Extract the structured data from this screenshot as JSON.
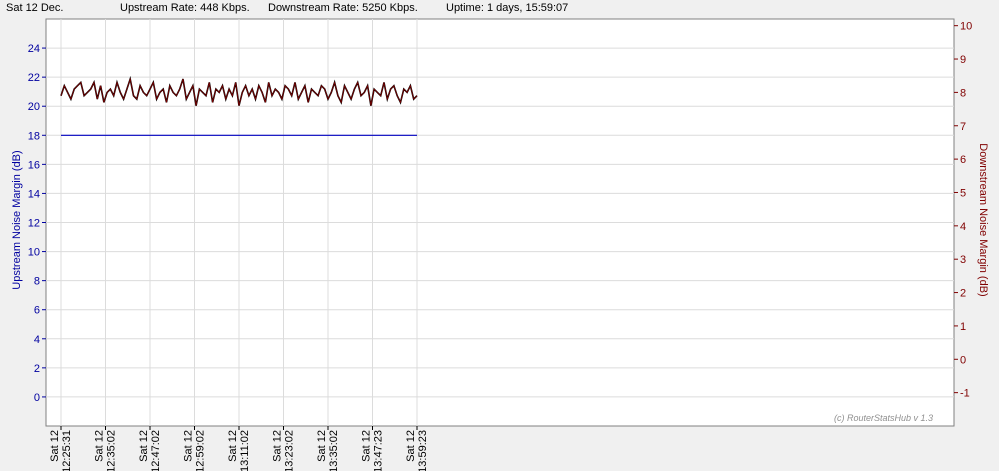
{
  "header": {
    "date": "Sat 12 Dec.",
    "upstream_rate": "Upstream Rate: 448 Kbps.",
    "downstream_rate": "Downstream Rate: 5250 Kbps.",
    "uptime": "Uptime: 1 days, 15:59:07"
  },
  "watermark": "(c) RouterStatsHub v 1.3",
  "colors": {
    "upstream": "#0000c0",
    "downstream": "#800000",
    "downstream_outline": "#000000",
    "grid": "#dcdcdc",
    "plot_bg": "#ffffff"
  },
  "chart_data": {
    "type": "line",
    "ylabel": "Upstream Noise Margin (dB)",
    "y2label": "Downstream Noise Margin (dB)",
    "ylim": [
      -2,
      26
    ],
    "y2lim": [
      -2,
      10.2
    ],
    "yticks": [
      0,
      2,
      4,
      6,
      8,
      10,
      12,
      14,
      16,
      18,
      20,
      22,
      24
    ],
    "y2ticks": [
      -1,
      0,
      1,
      2,
      3,
      4,
      5,
      6,
      7,
      8,
      9,
      10
    ],
    "grid": true,
    "x_labels": [
      [
        "Sat 12",
        "12:25:31"
      ],
      [
        "Sat 12",
        "12:35:02"
      ],
      [
        "Sat 12",
        "12:47:02"
      ],
      [
        "Sat 12",
        "12:59:02"
      ],
      [
        "Sat 12",
        "13:11:02"
      ],
      [
        "Sat 12",
        "13:23:02"
      ],
      [
        "Sat 12",
        "13:35:02"
      ],
      [
        "Sat 12",
        "13:47:23"
      ],
      [
        "Sat 12",
        "13:59:23"
      ]
    ],
    "series": [
      {
        "name": "Upstream Noise Margin (dB)",
        "axis": "left",
        "values": [
          18,
          18
        ]
      },
      {
        "name": "Downstream Noise Margin (dB)",
        "axis": "right",
        "values": [
          7.9,
          8.2,
          8.0,
          7.8,
          8.1,
          8.2,
          8.3,
          7.9,
          8.0,
          8.1,
          8.3,
          7.8,
          8.2,
          7.7,
          8.0,
          8.1,
          7.9,
          8.3,
          8.0,
          7.8,
          8.1,
          8.4,
          7.9,
          7.8,
          8.2,
          8.0,
          7.9,
          8.1,
          8.3,
          7.8,
          8.0,
          8.1,
          7.7,
          8.2,
          8.0,
          7.9,
          8.1,
          8.4,
          7.8,
          8.0,
          8.2,
          7.6,
          8.1,
          8.0,
          7.9,
          8.3,
          7.7,
          8.1,
          8.0,
          8.2,
          7.8,
          8.1,
          7.9,
          8.3,
          7.6,
          8.0,
          8.2,
          7.9,
          8.1,
          7.8,
          8.2,
          8.0,
          7.7,
          8.3,
          7.9,
          8.1,
          8.0,
          7.8,
          8.2,
          8.1,
          7.9,
          8.3,
          7.8,
          8.0,
          8.2,
          7.7,
          8.1,
          8.0,
          7.9,
          8.2,
          8.1,
          7.8,
          8.0,
          8.3,
          7.9,
          7.7,
          8.2,
          8.0,
          7.8,
          8.1,
          8.3,
          7.9,
          8.0,
          8.2,
          7.6,
          8.1,
          8.0,
          7.9,
          8.3,
          7.8,
          8.1,
          8.2,
          7.9,
          7.7,
          8.1,
          8.0,
          8.2,
          7.8,
          7.9
        ]
      }
    ]
  }
}
